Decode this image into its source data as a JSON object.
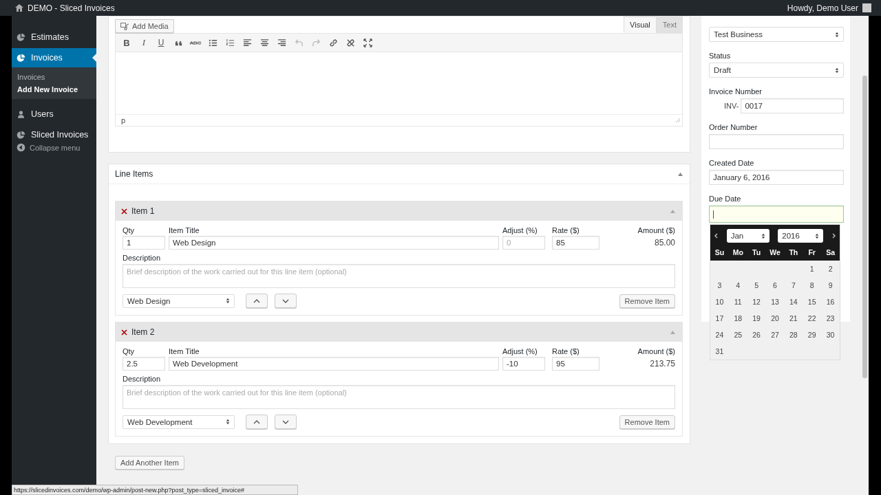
{
  "admin_bar": {
    "site_title": "DEMO - Sliced Invoices",
    "greeting": "Howdy, Demo User"
  },
  "sidebar": {
    "items": [
      {
        "label": "Estimates",
        "kind": "pie",
        "selected": false
      },
      {
        "label": "Invoices",
        "kind": "pie",
        "selected": true,
        "children": [
          {
            "label": "Invoices",
            "selected": false
          },
          {
            "label": "Add New Invoice",
            "selected": true
          }
        ]
      },
      {
        "label": "Users",
        "kind": "user",
        "selected": false
      },
      {
        "label": "Sliced Invoices",
        "kind": "pie",
        "selected": false
      }
    ],
    "collapse": "Collapse menu"
  },
  "editor": {
    "add_media": "Add Media",
    "tabs": [
      {
        "label": "Visual",
        "selected": true
      },
      {
        "label": "Text",
        "selected": false
      }
    ],
    "toolbar": [
      {
        "kind": "bold",
        "text": "B",
        "disabled": false
      },
      {
        "kind": "italic",
        "text": "I",
        "disabled": false
      },
      {
        "kind": "underline",
        "text": "U",
        "disabled": false
      },
      {
        "kind": "quote",
        "disabled": false
      },
      {
        "kind": "strike",
        "text": "ABC",
        "disabled": false
      },
      {
        "kind": "bullets",
        "disabled": false
      },
      {
        "kind": "numbers",
        "disabled": false
      },
      {
        "kind": "align-left",
        "disabled": false
      },
      {
        "kind": "align-center",
        "disabled": false
      },
      {
        "kind": "align-right",
        "disabled": false
      },
      {
        "kind": "undo",
        "disabled": true
      },
      {
        "kind": "redo",
        "disabled": true
      },
      {
        "kind": "link",
        "disabled": false
      },
      {
        "kind": "unlink",
        "disabled": false
      },
      {
        "kind": "fullscreen",
        "disabled": false
      }
    ],
    "path": "p"
  },
  "line_items": {
    "title": "Line Items",
    "items": [
      {
        "heading": "Item 1",
        "labels": {
          "qty": "Qty",
          "title": "Item Title",
          "adjust": "Adjust (%)",
          "rate": "Rate ($)",
          "amount": "Amount ($)",
          "description": "Description"
        },
        "qty": "1",
        "item_title": "Web Design",
        "adjust": {
          "placeholder": "0"
        },
        "rate": "85",
        "amount": "85.00",
        "description": {
          "placeholder": "Brief description of the work carried out for this line item (optional)"
        },
        "type": "Web Design",
        "remove": "Remove Item"
      },
      {
        "heading": "Item 2",
        "labels": {
          "qty": "Qty",
          "title": "Item Title",
          "adjust": "Adjust (%)",
          "rate": "Rate ($)",
          "amount": "Amount ($)",
          "description": "Description"
        },
        "qty": "2.5",
        "item_title": "Web Development",
        "adjust": {
          "value": "-10"
        },
        "rate": "95",
        "amount": "213.75",
        "description": {
          "placeholder": "Brief description of the work carried out for this line item (optional)"
        },
        "type": "Web Development",
        "remove": "Remove Item"
      }
    ],
    "add_button": "Add Another Item"
  },
  "details": {
    "fields": [
      {
        "kind": "select",
        "value": "Test Business",
        "focused": false
      },
      {
        "label": "Status",
        "kind": "select",
        "value": "Draft",
        "focused": false
      },
      {
        "label": "Invoice Number",
        "kind": "prefixed",
        "prefix": "INV-",
        "value": "0017",
        "focused": false
      },
      {
        "label": "Order Number",
        "kind": "text",
        "focused": false
      },
      {
        "label": "Created Date",
        "kind": "text",
        "value": "January 6, 2016",
        "focused": false
      },
      {
        "label": "Due Date",
        "kind": "text",
        "focused": true
      }
    ]
  },
  "datepicker": {
    "month": "Jan",
    "year": "2016",
    "weekdays": [
      "Su",
      "Mo",
      "Tu",
      "We",
      "Th",
      "Fr",
      "Sa"
    ],
    "weeks": [
      {
        "days": [
          "1",
          "2"
        ]
      },
      {
        "days": [
          "3",
          "4",
          "5",
          "6",
          "7",
          "8",
          "9"
        ]
      },
      {
        "days": [
          "10",
          "11",
          "12",
          "13",
          "14",
          "15",
          "16"
        ]
      },
      {
        "days": [
          "17",
          "18",
          "19",
          "20",
          "21",
          "22",
          "23"
        ]
      },
      {
        "days": [
          "24",
          "25",
          "26",
          "27",
          "28",
          "29",
          "30"
        ]
      },
      {
        "days": [
          "31"
        ]
      }
    ]
  },
  "status_url": "https://slicedinvoices.com/demo/wp-admin/post-new.php?post_type=sliced_invoice#"
}
